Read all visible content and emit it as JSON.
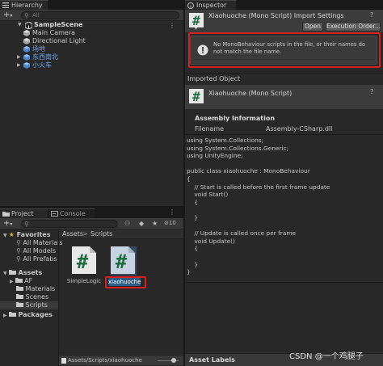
{
  "hierarchy": {
    "tab_label": "Hierarchy",
    "search_placeholder": "All",
    "scene": "SampleScene",
    "items": [
      "Main Camera",
      "Directional Light",
      "场地",
      "东西南北",
      "小火车"
    ]
  },
  "project": {
    "tabs": [
      "Project",
      "Console"
    ],
    "hidden_count": "10",
    "favorites_label": "Favorites",
    "favorites": [
      "All Materials",
      "All Models",
      "All Prefabs"
    ],
    "assets_label": "Assets",
    "assets_children": [
      "AF",
      "Materials",
      "Scenes",
      "Scripts"
    ],
    "packages_label": "Packages",
    "breadcrumb": [
      "Assets",
      "Scripts"
    ],
    "files": [
      "SimpleLogic",
      "xiaohuoche"
    ],
    "status_path": "Assets/Scripts/xiaohuoche"
  },
  "inspector": {
    "tab_label": "Inspector",
    "title": "Xiaohuoche (Mono Script) Import Settings",
    "open_button": "Open",
    "execution_order_button": "Execution Order...",
    "warning": "No MonoBehaviour scripts in the file, or their names do not match the file name.",
    "imported_object_label": "Imported Object",
    "imported_object_title": "Xiaohuoche (Mono Script)",
    "assembly_header": "Assembly Information",
    "filename_label": "Filename",
    "filename_value": "Assembly-CSharp.dll",
    "code_lines": [
      "using System.Collections;",
      "using System.Collections.Generic;",
      "using UnityEngine;",
      "",
      "public class xiaohuoche : MonoBehaviour",
      "{",
      "    // Start is called before the first frame update",
      "    void Start()",
      "    {",
      "",
      "    }",
      "",
      "    // Update is called once per frame",
      "    void Update()",
      "    {",
      "",
      "    }",
      "}"
    ],
    "asset_labels": "Asset Labels"
  },
  "watermark": "CSDN @一个鸡腿子",
  "colors": {
    "highlight_red": "#d82020",
    "script_green": "#1e6d3c",
    "folder": "#c9c9c9"
  }
}
